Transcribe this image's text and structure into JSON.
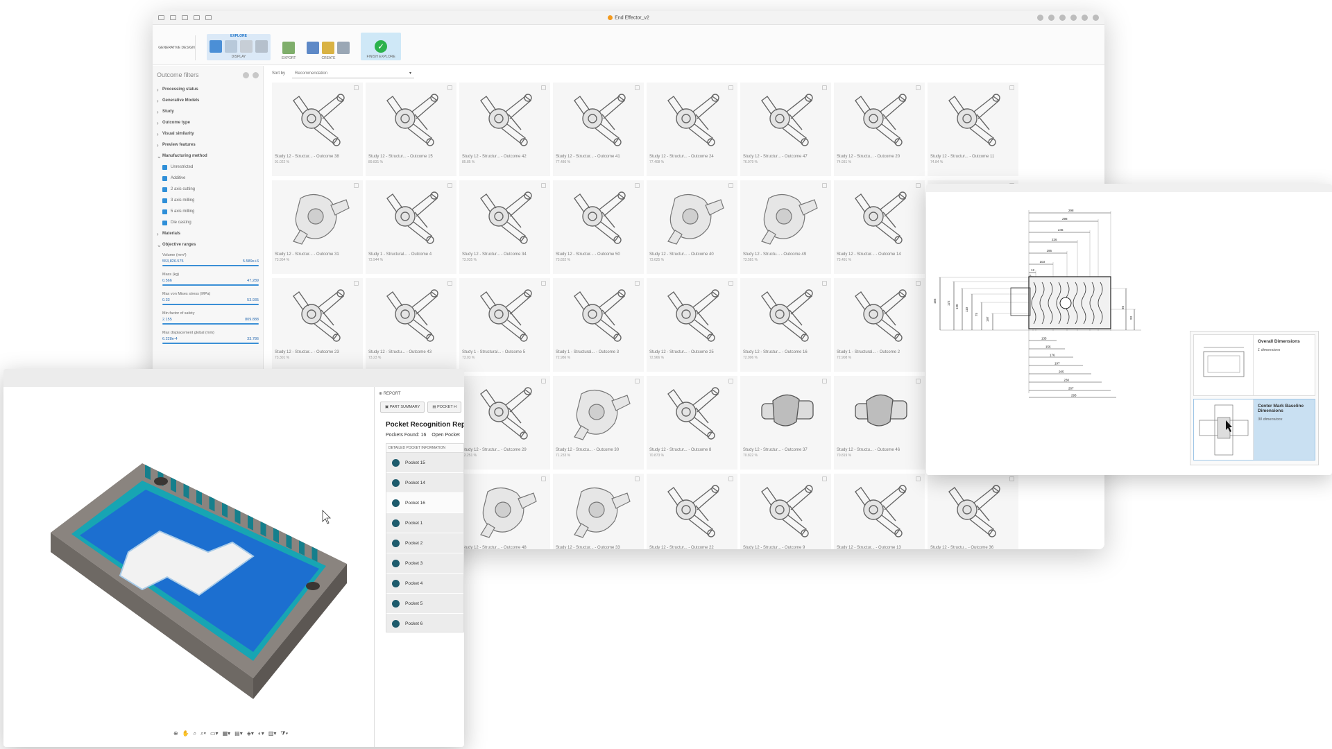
{
  "main_window": {
    "title": "End Effector_v2",
    "workspace": "GENERATIVE DESIGN",
    "toolbar": {
      "active_tab": "EXPLORE",
      "groups": [
        "DISPLAY",
        "EXPORT",
        "CREATE",
        "FINISH EXPLORE"
      ]
    },
    "sidebar": {
      "title": "Outcome filters",
      "sections": [
        "Processing status",
        "Generative Models",
        "Study",
        "Outcome type",
        "Visual similarity",
        "Preview features"
      ],
      "manufacturing_label": "Manufacturing method",
      "methods": [
        "Unrestricted",
        "Additive",
        "2 axis cutting",
        "3 axis milling",
        "5 axis milling",
        "Die casting"
      ],
      "materials_label": "Materials",
      "objective_label": "Objective ranges",
      "ranges": [
        {
          "label": "Volume (mm³)",
          "min": "553,826.575",
          "max": "5.589e+6"
        },
        {
          "label": "Mass (kg)",
          "min": "0.566",
          "max": "47.289"
        },
        {
          "label": "Max von Mises stress (MPa)",
          "min": "0.33",
          "max": "53.935"
        },
        {
          "label": "Min factor of safety",
          "min": "2.155",
          "max": "809.888"
        },
        {
          "label": "Max displacement global (mm)",
          "min": "6.228e-4",
          "max": "33.786"
        }
      ]
    },
    "sort": {
      "label": "Sort by",
      "value": "Recommendation"
    },
    "outcomes": [
      {
        "name": "Study 12 - Structur... - Outcome 38",
        "pct": "91.022 %"
      },
      {
        "name": "Study 12 - Structur... - Outcome 15",
        "pct": "89.831 %"
      },
      {
        "name": "Study 12 - Structur... - Outcome 42",
        "pct": "85.85 %"
      },
      {
        "name": "Study 12 - Structur... - Outcome 41",
        "pct": "77.486 %"
      },
      {
        "name": "Study 12 - Structur... - Outcome 24",
        "pct": "77.408 %"
      },
      {
        "name": "Study 12 - Structur... - Outcome 47",
        "pct": "76.979 %"
      },
      {
        "name": "Study 12 - Structu... - Outcome 20",
        "pct": "74.931 %"
      },
      {
        "name": "Study 12 - Structur... - Outcome 11",
        "pct": "74.84 %"
      },
      {
        "name": "Study 12 - Structur... - Outcome 31",
        "pct": "73.954 %"
      },
      {
        "name": "Study 1 - Structural... - Outcome 4",
        "pct": "73.944 %"
      },
      {
        "name": "Study 12 - Structur... - Outcome 34",
        "pct": "73.935 %"
      },
      {
        "name": "Study 12 - Structur... - Outcome 50",
        "pct": "73.832 %"
      },
      {
        "name": "Study 12 - Structur... - Outcome 40",
        "pct": "73.625 %"
      },
      {
        "name": "Study 12 - Structu... - Outcome 49",
        "pct": "73.581 %"
      },
      {
        "name": "Study 12 - Structur... - Outcome 14",
        "pct": "73.491 %"
      },
      {
        "name": "",
        "pct": ""
      },
      {
        "name": "Study 12 - Structur... - Outcome 23",
        "pct": "73.301 %"
      },
      {
        "name": "Study 12 - Structu... - Outcome 43",
        "pct": "73.23 %"
      },
      {
        "name": "Study 1 - Structural... - Outcome 5",
        "pct": "73.03 %"
      },
      {
        "name": "Study 1 - Structural... - Outcome 3",
        "pct": "72.986 %"
      },
      {
        "name": "Study 12 - Structur... - Outcome 25",
        "pct": "72.966 %"
      },
      {
        "name": "Study 12 - Structur... - Outcome 16",
        "pct": "72.906 %"
      },
      {
        "name": "Study 1 - Structural... - Outcome 2",
        "pct": "72.908 %"
      },
      {
        "name": "",
        "pct": ""
      },
      {
        "name": "",
        "pct": ""
      },
      {
        "name": "",
        "pct": ""
      },
      {
        "name": "Study 12 - Structur... - Outcome 29",
        "pct": "72.251 %"
      },
      {
        "name": "Study 12 - Structu... - Outcome 30",
        "pct": "71.233 %"
      },
      {
        "name": "Study 12 - Structur... - Outcome 8",
        "pct": "70.873 %"
      },
      {
        "name": "Study 12 - Structur... - Outcome 37",
        "pct": "70.822 %"
      },
      {
        "name": "Study 12 - Structu... - Outcome 46",
        "pct": "70.819 %"
      },
      {
        "name": "",
        "pct": ""
      },
      {
        "name": "",
        "pct": ""
      },
      {
        "name": "",
        "pct": ""
      },
      {
        "name": "Study 12 - Structur... - Outcome 48",
        "pct": "69.99 %"
      },
      {
        "name": "Study 12 - Structur... - Outcome 33",
        "pct": "69.693 %"
      },
      {
        "name": "Study 12 - Structur... - Outcome 22",
        "pct": "69.453 %"
      },
      {
        "name": "Study 12 - Structur... - Outcome 9",
        "pct": "69.579 %"
      },
      {
        "name": "Study 12 - Structur... - Outcome 13",
        "pct": "69.136 %"
      },
      {
        "name": "Study 12 - Structu... - Outcome 36",
        "pct": "69.207 %"
      }
    ]
  },
  "drawing_window": {
    "panel_items": [
      {
        "title": "Overall Dimensions",
        "subtitle": "1 dimensions"
      },
      {
        "title": "Center Mark Baseline Dimensions",
        "subtitle": "30 dimensions"
      }
    ],
    "dim_labels": [
      "298",
      "298",
      "246",
      "226",
      "195",
      "103",
      "12",
      "5",
      "135",
      "156",
      "176",
      "197",
      "205",
      "230",
      "267",
      "293",
      "165",
      "172",
      "120",
      "110",
      "75",
      "197",
      "66",
      "23"
    ]
  },
  "pocket_window": {
    "report_label": "REPORT",
    "tabs": [
      "PART SUMMARY",
      "POCKET H"
    ],
    "title": "Pocket Recognition Report",
    "pockets_found": "Pockets Found: 16",
    "open_pockets": "Open Pocket",
    "detail_header": "DETAILED POCKET INFORMATION",
    "pockets": [
      "Pocket 15",
      "Pocket 14",
      "Pocket 16",
      "Pocket 1",
      "Pocket 2",
      "Pocket 3",
      "Pocket 4",
      "Pocket 5",
      "Pocket 6"
    ],
    "colors": {
      "pocket_teal": "#1d5b6c",
      "floor_blue": "#1c6fd0",
      "wall_cyan": "#1ab7c2",
      "part_gray": "#8a847f"
    }
  }
}
